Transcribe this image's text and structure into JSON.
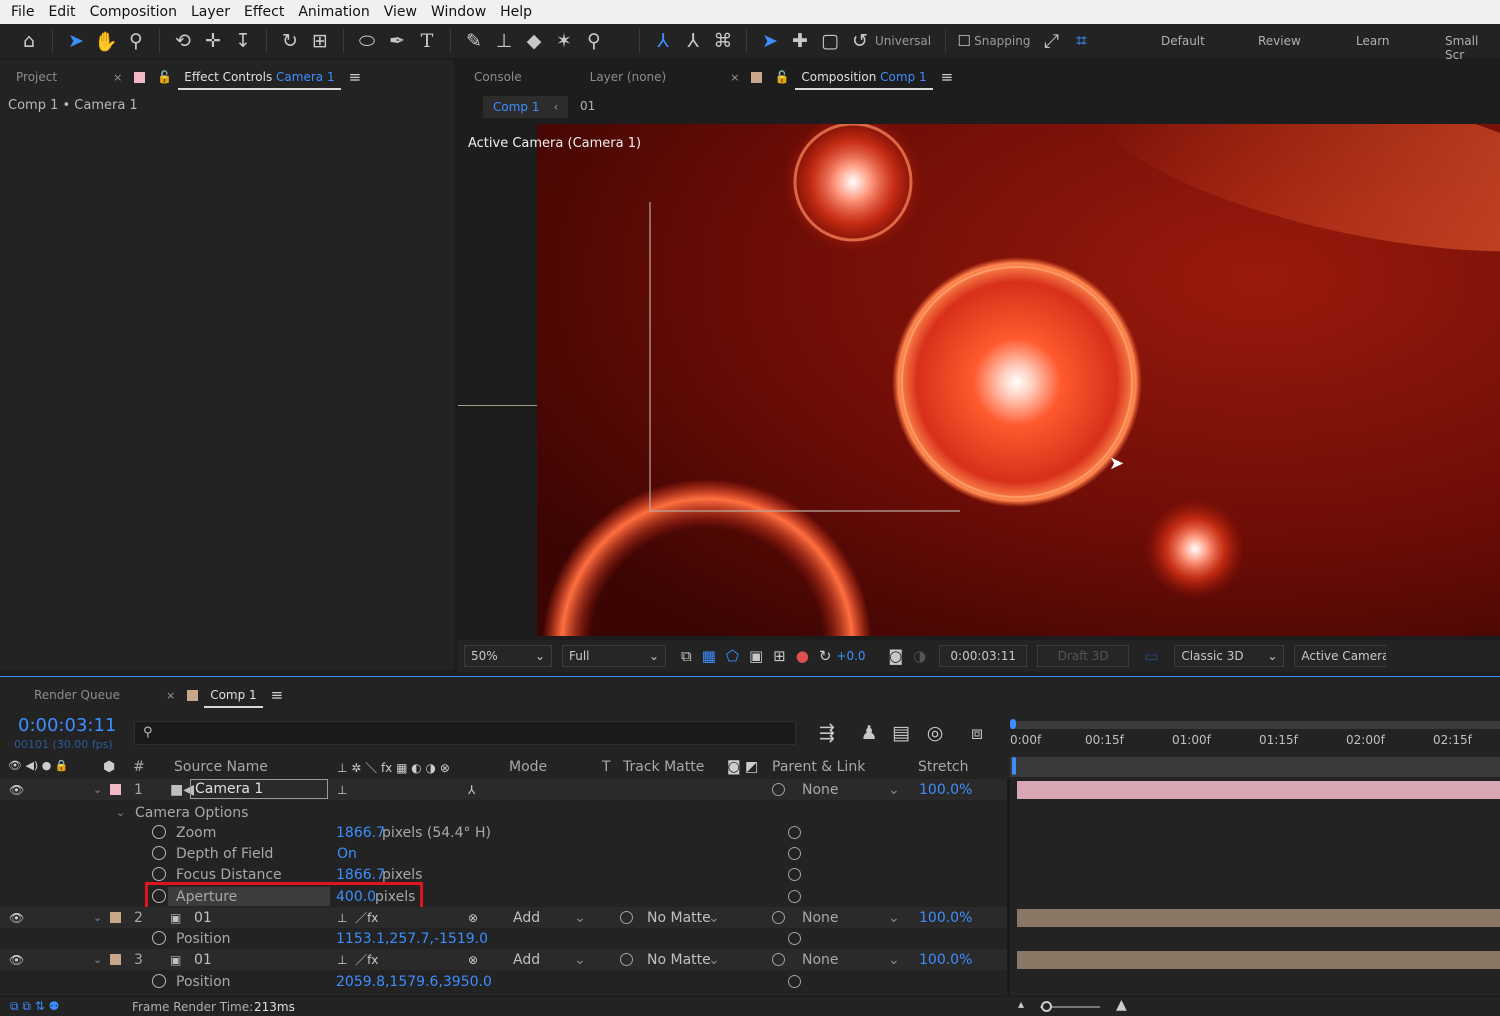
{
  "menu": [
    "File",
    "Edit",
    "Composition",
    "Layer",
    "Effect",
    "Animation",
    "View",
    "Window",
    "Help"
  ],
  "toolbar": {
    "axis_mode": "Universal",
    "snapping": "Snapping",
    "workspaces": [
      "Default",
      "Review",
      "Learn",
      "Small Scr"
    ]
  },
  "left_panel": {
    "tab_project": "Project",
    "tab_effect": "Effect Controls",
    "tab_effect_target": "Camera 1",
    "breadcrumb": "Comp 1 • Camera 1"
  },
  "viewer_panel": {
    "tab_console": "Console",
    "tab_layer": "Layer (none)",
    "tab_comp": "Composition",
    "tab_comp_target": "Comp 1",
    "subtab_comp": "Comp 1",
    "subtab_layer": "01",
    "active_camera_label": "Active Camera (Camera 1)"
  },
  "viewer_bar": {
    "zoom": "50%",
    "resolution": "Full",
    "exposure": "+0.0",
    "timecode": "0:00:03:11",
    "draft": "Draft 3D",
    "renderer": "Classic 3D",
    "view": "Active Camera"
  },
  "timeline": {
    "tab_render": "Render Queue",
    "tab_comp": "Comp 1",
    "timecode": "0:00:03:11",
    "frame_info": "00101 (30.00 fps)",
    "col_num": "#",
    "col_source": "Source Name",
    "col_mode": "Mode",
    "col_t": "T",
    "col_track": "Track Matte",
    "col_parent": "Parent & Link",
    "col_stretch": "Stretch",
    "ruler": [
      "0:00f",
      "00:15f",
      "01:00f",
      "01:15f",
      "02:00f",
      "02:15f"
    ],
    "status": "Frame Render Time:",
    "render_time": "213ms"
  },
  "layers": [
    {
      "num": "1",
      "name": "Camera 1",
      "color": "#f2b8c6",
      "parent": "None",
      "stretch": "100.0%"
    },
    {
      "num": "2",
      "name": "01",
      "color": "#c9a88a",
      "mode": "Add",
      "matte": "No Matte",
      "parent": "None",
      "stretch": "100.0%"
    },
    {
      "num": "3",
      "name": "01",
      "color": "#c9a88a",
      "mode": "Add",
      "matte": "No Matte",
      "parent": "None",
      "stretch": "100.0%"
    }
  ],
  "camera_options": {
    "group": "Camera Options",
    "zoom_label": "Zoom",
    "zoom_value": "1866.7",
    "zoom_unit": "pixels (54.4° H)",
    "dof_label": "Depth of Field",
    "dof_value": "On",
    "focus_label": "Focus Distance",
    "focus_value": "1866.7",
    "focus_unit": "pixels",
    "aperture_label": "Aperture",
    "aperture_value": "400.0",
    "aperture_unit": "pixels"
  },
  "layer2_position": {
    "label": "Position",
    "value": "1153.1,257.7,-1519.0"
  },
  "layer3_position": {
    "label": "Position",
    "value": "2059.8,1579.6,3950.0"
  },
  "colors": {
    "accent": "#3d8eff",
    "highlight_box": "#e0141e",
    "camera_bar": "#d9a7b4",
    "footage_bar": "#8a7766"
  }
}
